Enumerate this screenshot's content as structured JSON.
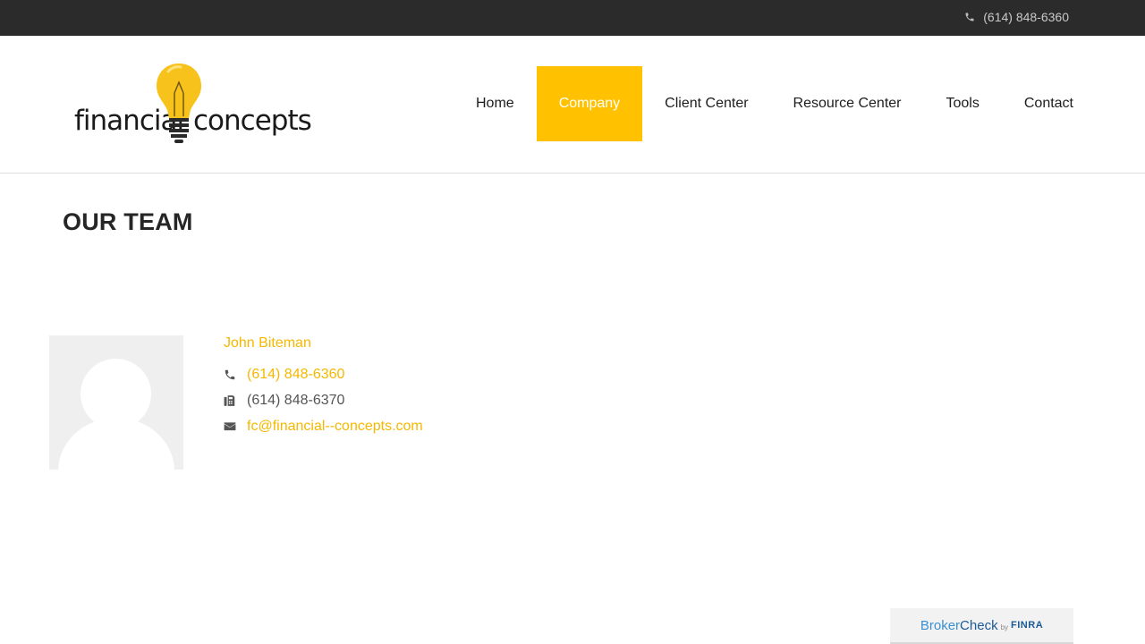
{
  "topbar": {
    "phone": "(614) 848-6360"
  },
  "logo": {
    "word_left": "financial",
    "word_right": "concepts"
  },
  "nav": {
    "items": [
      {
        "label": "Home",
        "active": false
      },
      {
        "label": "Company",
        "active": true
      },
      {
        "label": "Client Center",
        "active": false
      },
      {
        "label": "Resource Center",
        "active": false
      },
      {
        "label": "Tools",
        "active": false
      },
      {
        "label": "Contact",
        "active": false
      }
    ]
  },
  "page": {
    "title": "OUR TEAM"
  },
  "member": {
    "name": "John Biteman",
    "phone": "(614) 848-6360",
    "fax": "(614) 848-6370",
    "email": "fc@financial--concepts.com",
    "icons": {
      "phone": "phone-icon",
      "fax": "fax-icon",
      "email": "envelope-icon"
    }
  },
  "brokercheck": {
    "part1": "Broker",
    "part2": "Check",
    "by": "by",
    "org": "FINRA"
  },
  "colors": {
    "accent": "#ffc100",
    "topbar": "#2b2b2b",
    "link": "#f5b800"
  }
}
